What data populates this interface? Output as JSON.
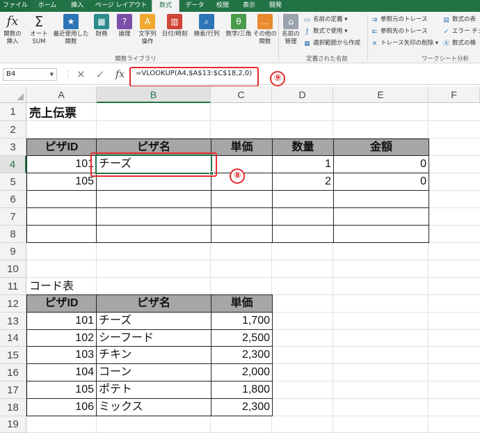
{
  "ribbon_tabs": [
    "ファイル",
    "ホーム",
    "挿入",
    "ページ レイアウト",
    "数式",
    "データ",
    "校閲",
    "表示",
    "開発"
  ],
  "active_tab": "数式",
  "ribbon": {
    "insert_function": "関数の\n挿入",
    "autosum": "オート\nSUM",
    "recent": "最近使用した\n関数",
    "financial": "財務",
    "logical": "論理",
    "text": "文字列\n操作",
    "datetime": "日付/時刻",
    "lookup": "検索/行列",
    "math": "数学/三角",
    "more": "その他の\n関数",
    "group_function_library": "関数ライブラリ",
    "name_manager": "名前の\n管理",
    "define_name": "名前の定義",
    "use_in_formula": "数式で使用",
    "create_from_selection": "選択範囲から作成",
    "group_defined_names": "定義された名前",
    "trace_precedents": "参照元のトレース",
    "trace_dependents": "参照先のトレース",
    "remove_arrows": "トレース矢印の削除",
    "show_formulas": "数式の表",
    "error_check": "エラー チェ",
    "evaluate_formula": "数式の検",
    "group_formula_auditing": "ワークシート分析"
  },
  "formula_bar": {
    "name_box": "B4",
    "formula": "=VLOOKUP(A4,$A$13:$C$18,2,0)"
  },
  "annotations": {
    "nine": "⑨",
    "eight": "⑧"
  },
  "columns": [
    "A",
    "B",
    "C",
    "D",
    "E",
    "F"
  ],
  "rows": [
    "1",
    "2",
    "3",
    "4",
    "5",
    "6",
    "7",
    "8",
    "9",
    "10",
    "11",
    "12",
    "13",
    "14",
    "15",
    "16",
    "17",
    "18",
    "19"
  ],
  "sales": {
    "title": "売上伝票",
    "headers": [
      "ピザID",
      "ピザ名",
      "単価",
      "数量",
      "金額"
    ],
    "rows": [
      {
        "id": "101",
        "name": "チーズ",
        "price": "",
        "qty": "1",
        "amount": "0"
      },
      {
        "id": "105",
        "name": "",
        "price": "",
        "qty": "2",
        "amount": "0"
      }
    ]
  },
  "code_table": {
    "title": "コード表",
    "headers": [
      "ピザID",
      "ピザ名",
      "単価"
    ],
    "rows": [
      {
        "id": "101",
        "name": "チーズ",
        "price": "1,700"
      },
      {
        "id": "102",
        "name": "シーフード",
        "price": "2,500"
      },
      {
        "id": "103",
        "name": "チキン",
        "price": "2,300"
      },
      {
        "id": "104",
        "name": "コーン",
        "price": "2,000"
      },
      {
        "id": "105",
        "name": "ポテト",
        "price": "1,800"
      },
      {
        "id": "106",
        "name": "ミックス",
        "price": "2,300"
      }
    ]
  },
  "colors": {
    "excel_green": "#217346",
    "annotation_red": "#e32b2b",
    "header_fill": "#a6a6a6"
  }
}
